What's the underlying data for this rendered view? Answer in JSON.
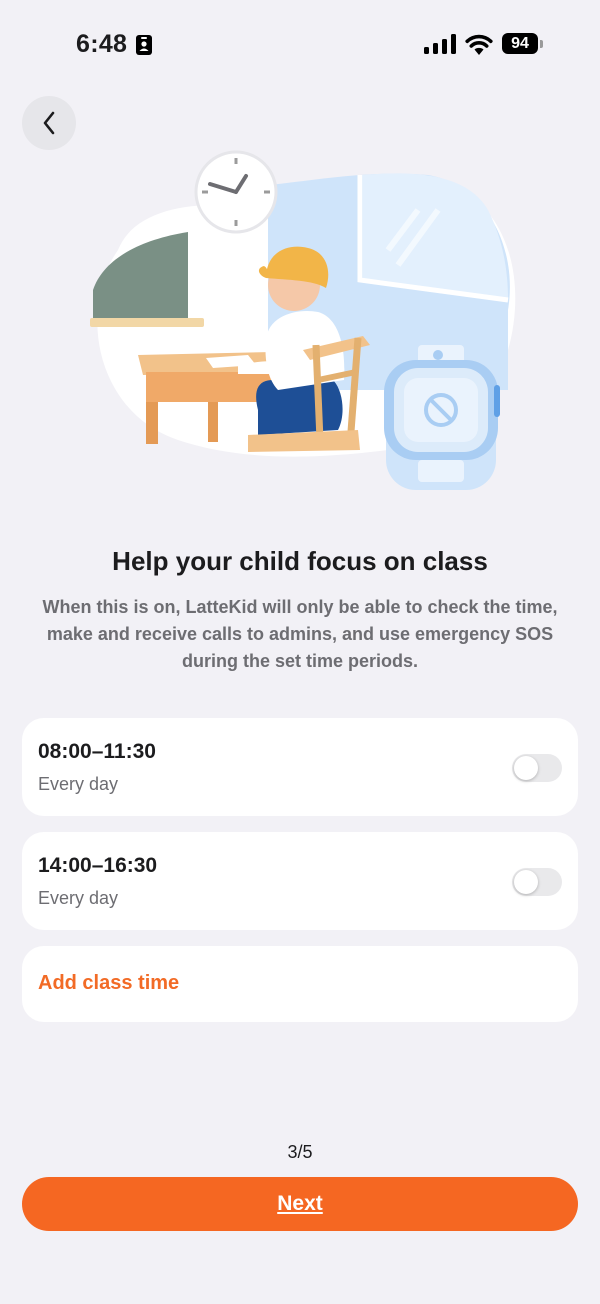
{
  "status_bar": {
    "time": "6:48",
    "battery": "94"
  },
  "onboarding": {
    "title": "Help your child focus on class",
    "description": "When this is on, LatteKid will only be able to check the time, make and receive calls to admins, and use emergency SOS during the set time periods."
  },
  "schedules": [
    {
      "time": "08:00–11:30",
      "repeat": "Every day",
      "enabled": false
    },
    {
      "time": "14:00–16:30",
      "repeat": "Every day",
      "enabled": false
    }
  ],
  "add_class_time_label": "Add class time",
  "pagination": "3/5",
  "next_label": "Next",
  "colors": {
    "accent": "#f56722",
    "background": "#f2f1f6",
    "toggle_off": "#e9e9eb"
  },
  "icons": [
    "id-card-icon",
    "signal-icon",
    "wifi-icon",
    "battery-icon",
    "back-chevron-icon",
    "no-entry-icon"
  ]
}
